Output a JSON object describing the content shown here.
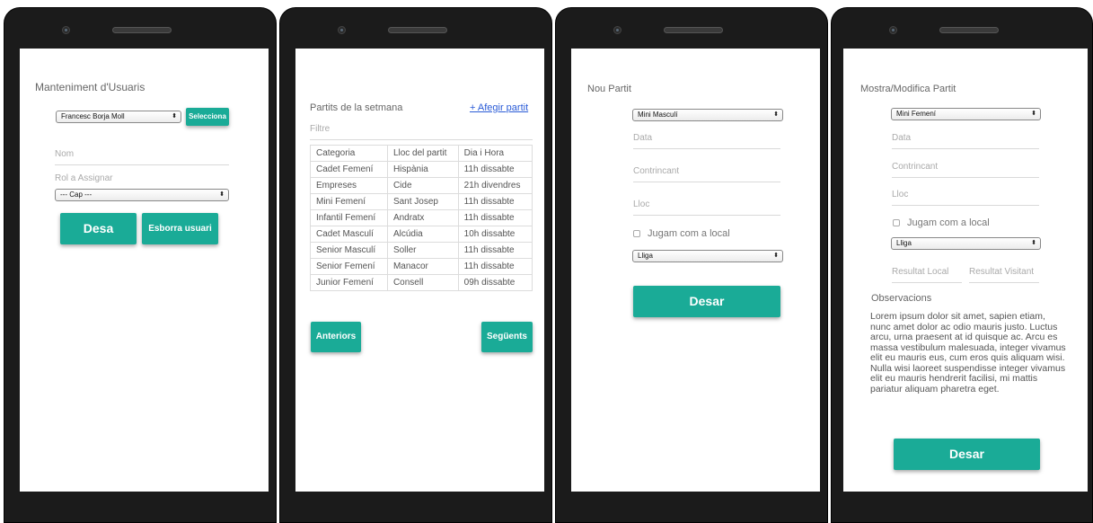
{
  "screen1": {
    "title": "Manteniment d'Usuaris",
    "user_select": "Francesc Borja Moll",
    "select_button": "Selecciona",
    "name_placeholder": "Nom",
    "role_label": "Rol a Assignar",
    "role_select": "--- Cap ---",
    "save_button": "Desa",
    "delete_button": "Esborra usuari"
  },
  "screen2": {
    "title": "Partits de la setmana",
    "add_link": "+ Afegir partit",
    "filter_placeholder": "Filtre",
    "headers": [
      "Categoria",
      "Lloc del partit",
      "Dia i Hora"
    ],
    "rows": [
      [
        "Cadet Femení",
        "Hispània",
        "11h dissabte"
      ],
      [
        "Empreses",
        "Cide",
        "21h divendres"
      ],
      [
        "Mini Femení",
        "Sant Josep",
        "11h dissabte"
      ],
      [
        "Infantil Femení",
        "Andratx",
        "11h dissabte"
      ],
      [
        "Cadet Masculí",
        "Alcúdia",
        "10h dissabte"
      ],
      [
        "Senior Masculí",
        "Soller",
        "11h dissabte"
      ],
      [
        "Senior Femení",
        "Manacor",
        "11h dissabte"
      ],
      [
        "Junior Femení",
        "Consell",
        "09h dissabte"
      ]
    ],
    "prev_button": "Anteriors",
    "next_button": "Següents"
  },
  "screen3": {
    "title": "Nou Partit",
    "category_select": "Mini Masculí",
    "date_placeholder": "Data",
    "opponent_placeholder": "Contrincant",
    "place_placeholder": "Lloc",
    "home_checkbox": "Jugam com a local",
    "competition_select": "Lliga",
    "save_button": "Desar"
  },
  "screen4": {
    "title": "Mostra/Modifica Partit",
    "category_select": "Mini Femení",
    "date_placeholder": "Data",
    "opponent_placeholder": "Contrincant",
    "place_placeholder": "Lloc",
    "home_checkbox": "Jugam com a local",
    "competition_select": "Lliga",
    "local_result_placeholder": "Resultat Local",
    "visitor_result_placeholder": "Resultat Visitant",
    "observations_label": "Observacions",
    "observations_text": "Lorem ipsum dolor sit amet, sapien etiam, nunc amet dolor ac odio mauris justo. Luctus arcu, urna praesent at id quisque ac. Arcu es massa vestibulum malesuada, integer vivamus elit eu mauris eus, cum eros quis aliquam wisi. Nulla wisi laoreet suspendisse integer vivamus elit eu mauris hendrerit facilisi, mi mattis pariatur aliquam pharetra eget.",
    "save_button": "Desar"
  },
  "colors": {
    "accent": "#1aab97",
    "link": "#2a5bd7",
    "device": "#1b1b1b"
  },
  "icons": [
    "camera-icon",
    "speaker-icon",
    "select-arrow-icon",
    "checkbox-icon"
  ]
}
